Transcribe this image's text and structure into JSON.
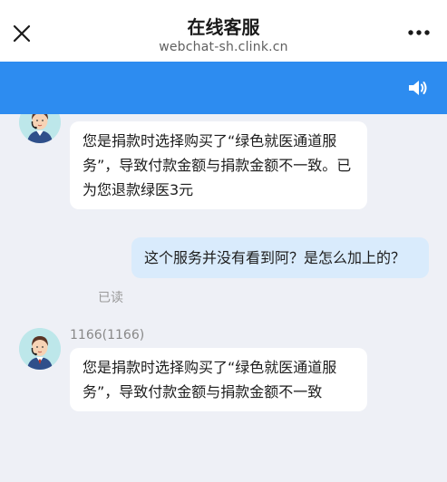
{
  "header": {
    "title": "在线客服",
    "subtitle": "webchat-sh.clink.cn",
    "close_icon": "close-icon",
    "more_icon": "more-icon"
  },
  "toolbar": {
    "speaker_icon": "speaker-icon",
    "color": "#2d8cf0"
  },
  "messages": [
    {
      "direction": "incoming",
      "sender": "",
      "text": "您是捐款时选择购买了“绿色就医通道服务”，导致付款金额与捐款金额不一致。已为您退款绿医3元"
    },
    {
      "direction": "outgoing",
      "status": "已读",
      "text": "这个服务并没有看到阿？是怎么加上的？"
    },
    {
      "direction": "incoming",
      "sender": "1166(1166)",
      "text": "您是捐款时选择购买了“绿色就医通道服务”，导致付款金额与捐款金额不一致"
    }
  ]
}
